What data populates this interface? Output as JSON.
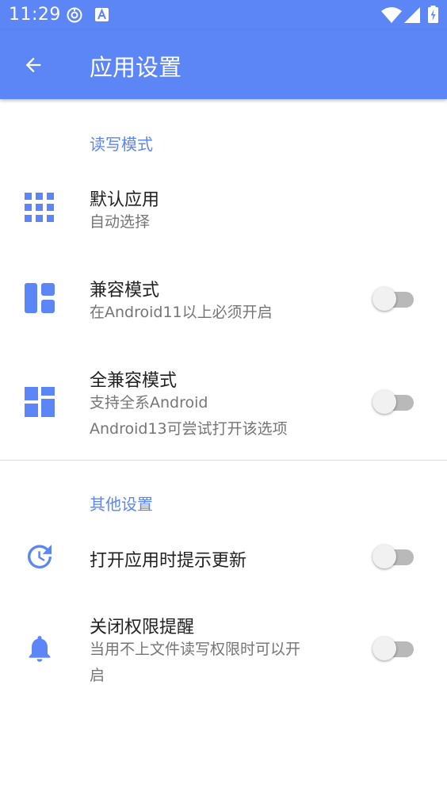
{
  "status_bar": {
    "time": "11:29",
    "icons": [
      "sync-icon",
      "a-icon",
      "wifi-icon",
      "signal-icon",
      "battery-charging-icon"
    ]
  },
  "app_bar": {
    "title": "应用设置",
    "back_icon": "arrow-back-icon"
  },
  "sections": {
    "read_write": {
      "header": "读写模式",
      "default_app": {
        "title": "默认应用",
        "subtitle": "自动选择"
      },
      "compat_mode": {
        "title": "兼容模式",
        "subtitle": "在Android11以上必须开启",
        "enabled": false
      },
      "full_compat_mode": {
        "title": "全兼容模式",
        "subtitle_line1": "支持全系Android",
        "subtitle_line2": "Android13可尝试打开该选项",
        "enabled": false
      }
    },
    "other": {
      "header": "其他设置",
      "update_prompt": {
        "title": "打开应用时提示更新",
        "enabled": false
      },
      "permission_reminder": {
        "title": "关闭权限提醒",
        "subtitle_line1": "当用不上文件读写权限时可以开",
        "subtitle_line2": "启",
        "enabled": false
      }
    }
  },
  "colors": {
    "accent": "#5c85f5",
    "switch_track_off": "#b9b9b9",
    "switch_thumb_off": "#f1f1f1"
  }
}
